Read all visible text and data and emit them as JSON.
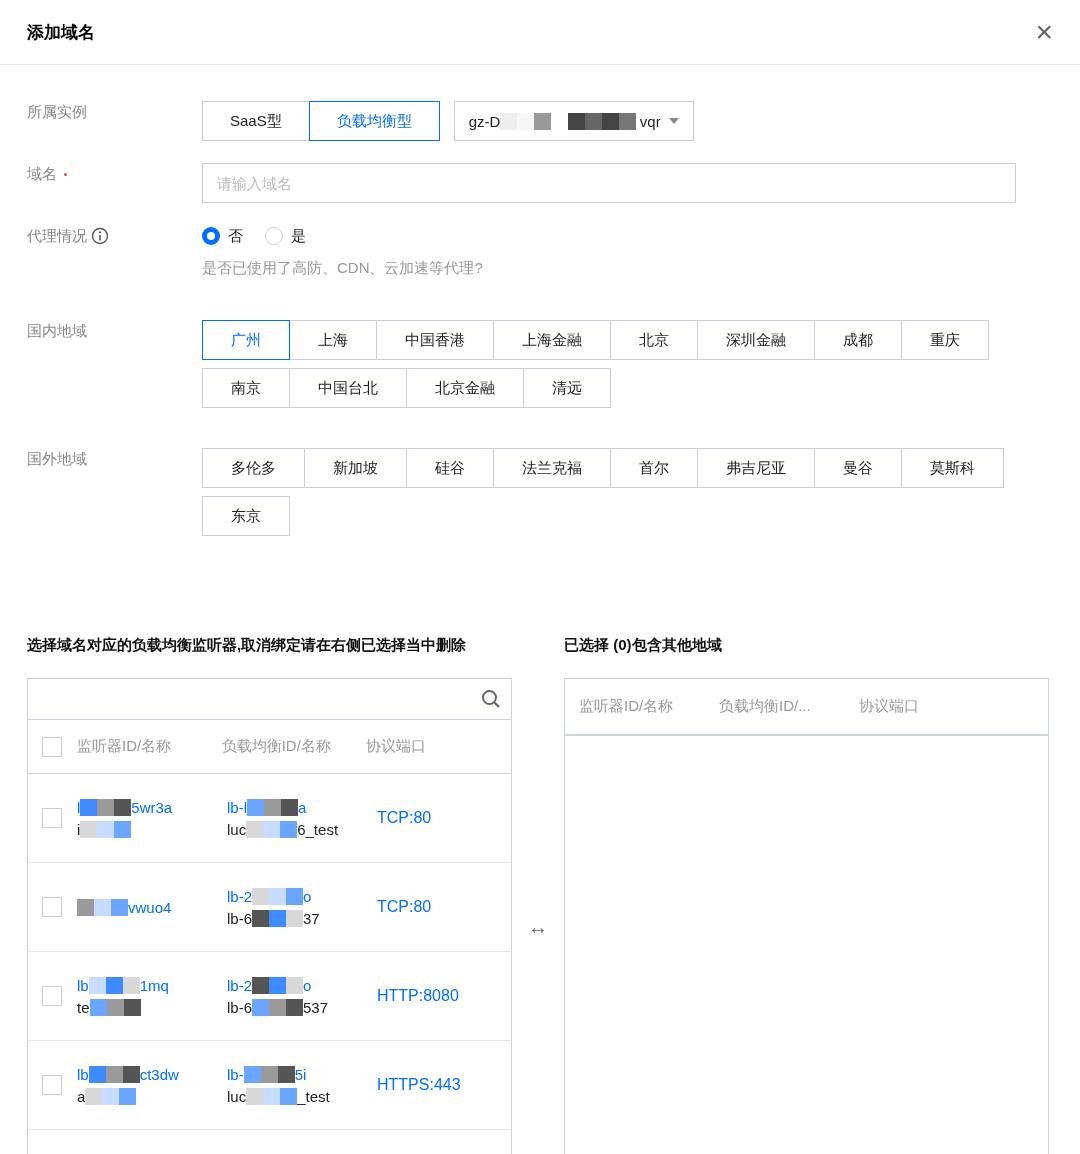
{
  "dialog": {
    "title": "添加域名",
    "close": "×"
  },
  "instance": {
    "label": "所属实例",
    "types": [
      {
        "label": "SaaS型",
        "selected": false
      },
      {
        "label": "负载均衡型",
        "selected": true
      }
    ],
    "select_before": "gz-D",
    "select_after": "vqr"
  },
  "domain": {
    "label": "域名",
    "required": true,
    "placeholder": "请输入域名"
  },
  "proxy": {
    "label": "代理情况",
    "options": [
      {
        "label": "否",
        "selected": true
      },
      {
        "label": "是",
        "selected": false
      }
    ],
    "hint": "是否已使用了高防、CDN、云加速等代理?"
  },
  "domestic": {
    "label": "国内地域",
    "regions": [
      {
        "label": "广州",
        "selected": true
      },
      {
        "label": "上海",
        "selected": false
      },
      {
        "label": "中国香港",
        "selected": false
      },
      {
        "label": "上海金融",
        "selected": false
      },
      {
        "label": "北京",
        "selected": false
      },
      {
        "label": "深圳金融",
        "selected": false
      },
      {
        "label": "成都",
        "selected": false
      },
      {
        "label": "重庆",
        "selected": false
      },
      {
        "label": "南京",
        "selected": false
      },
      {
        "label": "中国台北",
        "selected": false
      },
      {
        "label": "北京金融",
        "selected": false
      },
      {
        "label": "清远",
        "selected": false
      }
    ]
  },
  "overseas": {
    "label": "国外地域",
    "regions": [
      {
        "label": "多伦多",
        "selected": false
      },
      {
        "label": "新加坡",
        "selected": false
      },
      {
        "label": "硅谷",
        "selected": false
      },
      {
        "label": "法兰克福",
        "selected": false
      },
      {
        "label": "首尔",
        "selected": false
      },
      {
        "label": "弗吉尼亚",
        "selected": false
      },
      {
        "label": "曼谷",
        "selected": false
      },
      {
        "label": "莫斯科",
        "selected": false
      },
      {
        "label": "东京",
        "selected": false
      }
    ]
  },
  "left_panel": {
    "title": "选择域名对应的负载均衡监听器,取消绑定请在右侧已选择当中删除",
    "select_all_checked": false,
    "columns": [
      "监听器ID/名称",
      "负载均衡ID/名称",
      "协议端口"
    ],
    "rows": [
      {
        "checked": false,
        "listener": [
          {
            "before": "l",
            "after": "5wr3a"
          },
          {
            "before": "i"
          }
        ],
        "balancer": [
          {
            "before": "lb-l",
            "after": "a"
          },
          {
            "before": "luc",
            "after": "6_test"
          }
        ],
        "protocol": "TCP:80"
      },
      {
        "checked": false,
        "listener": [
          {
            "after": "vwuo4"
          }
        ],
        "balancer": [
          {
            "before": "lb-2",
            "after": "o"
          },
          {
            "before": "lb-6",
            "after": "37"
          }
        ],
        "protocol": "TCP:80"
      },
      {
        "checked": false,
        "listener": [
          {
            "before": "lb",
            "after": "1mq"
          },
          {
            "before": "te"
          }
        ],
        "balancer": [
          {
            "before": "lb-2",
            "after": "o"
          },
          {
            "before": "lb-6",
            "after": "537"
          }
        ],
        "protocol": "HTTP:8080"
      },
      {
        "checked": false,
        "listener": [
          {
            "before": "lb",
            "after": "ct3dw"
          },
          {
            "before": "a"
          }
        ],
        "balancer": [
          {
            "before": "lb-",
            "after": "5i"
          },
          {
            "before": "luc",
            "after": "_test"
          }
        ],
        "protocol": "HTTPS:443"
      }
    ]
  },
  "transfer": "↔",
  "right_panel": {
    "title": "已选择 (0)包含其他地域",
    "columns": [
      "监听器ID/名称",
      "负载均衡ID/...",
      "协议端口"
    ]
  }
}
